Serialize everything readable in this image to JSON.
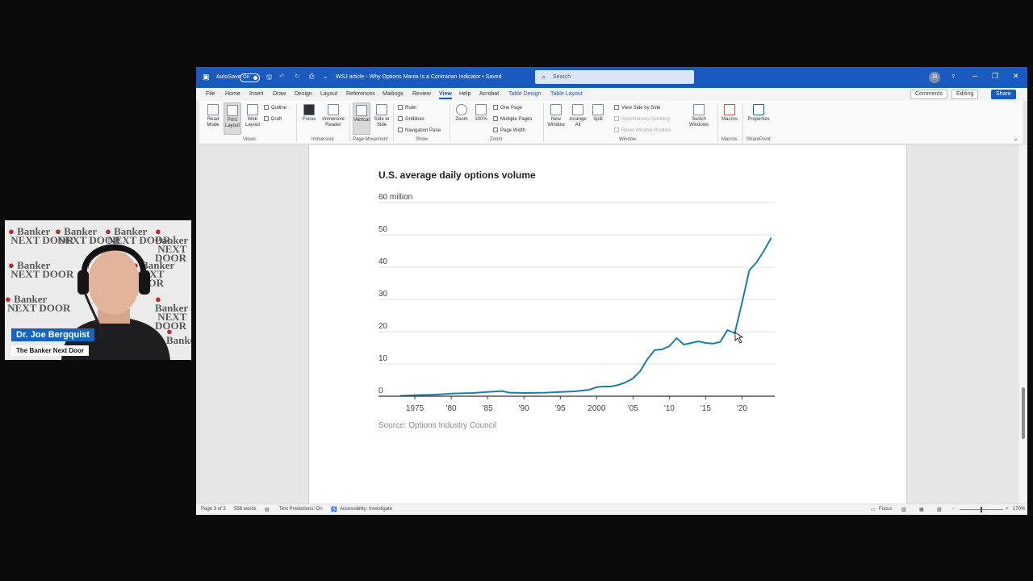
{
  "webcam": {
    "name": "Dr. Joe Bergquist",
    "show": "The Banker Next Door"
  },
  "titlebar": {
    "autosave_label": "AutoSave",
    "autosave_state": "On",
    "doc_title": "WSJ article - Why Options Mania Is a Contrarian Indicator • Saved",
    "search_placeholder": "Search",
    "user_initials": "JB"
  },
  "menu": {
    "tabs": [
      "File",
      "Home",
      "Insert",
      "Draw",
      "Design",
      "Layout",
      "References",
      "Mailings",
      "Review",
      "View",
      "Help",
      "Acrobat",
      "Table Design",
      "Table Layout"
    ],
    "active_tab": "View",
    "comments": "Comments",
    "editing": "Editing",
    "share": "Share"
  },
  "ribbon": {
    "read_mode": "Read Mode",
    "print_layout": "Print Layout",
    "web_layout": "Web Layout",
    "outline": "Outline",
    "draft": "Draft",
    "views_group": "Views",
    "focus": "Focus",
    "immersive_reader": "Immersive Reader",
    "immersive_group": "Immersive",
    "vertical": "Vertical",
    "side_to_side": "Side to Side",
    "page_movement_group": "Page Movement",
    "ruler": "Ruler",
    "gridlines": "Gridlines",
    "navigation_pane": "Navigation Pane",
    "show_group": "Show",
    "zoom": "Zoom",
    "zoom_100": "100%",
    "one_page": "One Page",
    "multiple_pages": "Multiple Pages",
    "page_width": "Page Width",
    "zoom_group": "Zoom",
    "new_window": "New Window",
    "arrange_all": "Arrange All",
    "split": "Split",
    "view_side_by_side": "View Side by Side",
    "synchronous_scrolling": "Synchronous Scrolling",
    "reset_window_position": "Reset Window Position",
    "switch_windows": "Switch Windows",
    "window_group": "Window",
    "macros": "Macros",
    "macros_group": "Macros",
    "properties": "Properties",
    "sharepoint_group": "SharePoint"
  },
  "chart_data": {
    "type": "line",
    "title": "U.S. average daily options volume",
    "unit_label": "60 million",
    "y_ticks": [
      0,
      10,
      20,
      30,
      40,
      50,
      60
    ],
    "x_tick_labels": [
      "1975",
      "'80",
      "'85",
      "'90",
      "'95",
      "2000",
      "'05",
      "'10",
      "'15",
      "'20"
    ],
    "x_tick_years": [
      1975,
      1980,
      1985,
      1990,
      1995,
      2000,
      2005,
      2010,
      2015,
      2020
    ],
    "xlim": [
      1970,
      2024.5
    ],
    "ylim": [
      0,
      60
    ],
    "x": [
      1973,
      1975,
      1978,
      1980,
      1983,
      1985,
      1987,
      1988,
      1990,
      1993,
      1995,
      1997,
      1999,
      2000,
      2001,
      2002,
      2003,
      2004,
      2005,
      2006,
      2007,
      2008,
      2009,
      2010,
      2011,
      2012,
      2013,
      2014,
      2015,
      2016,
      2017,
      2018,
      2019,
      2020,
      2021,
      2022,
      2023,
      2024
    ],
    "y": [
      0.1,
      0.3,
      0.5,
      0.8,
      1.0,
      1.3,
      1.6,
      1.1,
      1.0,
      1.1,
      1.3,
      1.5,
      2.0,
      2.8,
      3.0,
      3.0,
      3.5,
      4.3,
      5.5,
      7.8,
      11.5,
      14.3,
      14.5,
      15.5,
      18.0,
      16.0,
      16.5,
      17.0,
      16.5,
      16.3,
      16.8,
      20.5,
      19.5,
      29.0,
      39.0,
      41.5,
      45.0,
      49.0
    ],
    "source": "Source: Options Industry Council",
    "color": "#1d7ea3"
  },
  "status": {
    "page": "Page 3 of 3",
    "words": "558 words",
    "text_predictions": "Text Predictions: On",
    "accessibility": "Accessibility: Investigate",
    "focus": "Focus",
    "zoom_level": "170%"
  }
}
